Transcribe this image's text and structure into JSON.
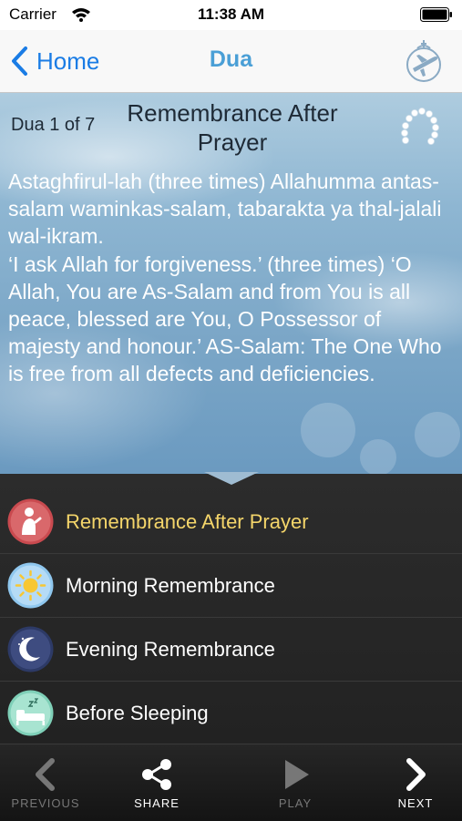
{
  "status_bar": {
    "carrier": "Carrier",
    "time": "11:38 AM"
  },
  "nav": {
    "back_label": "Home",
    "title": "Dua"
  },
  "dua": {
    "counter": "Dua 1 of 7",
    "title": "Remembrance After Prayer",
    "text": "Astaghfirul-lah (three times) Allahumma antas-salam waminkas-salam, tabarakta ya thal-jalali wal-ikram.\n‘I ask Allah for forgiveness.’ (three times) ‘O Allah, You are As-Salam and from You is all peace, blessed are You, O Possessor of majesty and honour.’ AS-Salam: The One Who is free from all defects and deficiencies."
  },
  "list": [
    {
      "label": "Remembrance After Prayer",
      "icon": "praying-person-icon",
      "active": true
    },
    {
      "label": "Morning Remembrance",
      "icon": "sun-icon",
      "active": false
    },
    {
      "label": "Evening Remembrance",
      "icon": "moon-icon",
      "active": false
    },
    {
      "label": "Before Sleeping",
      "icon": "bed-icon",
      "active": false
    }
  ],
  "toolbar": {
    "previous": "PREVIOUS",
    "share": "SHARE",
    "play": "PLAY",
    "next": "NEXT"
  },
  "colors": {
    "nav_tint": "#1a7ce5",
    "title": "#4a9fd6",
    "active_item": "#f4d56a",
    "disabled": "#777777"
  }
}
